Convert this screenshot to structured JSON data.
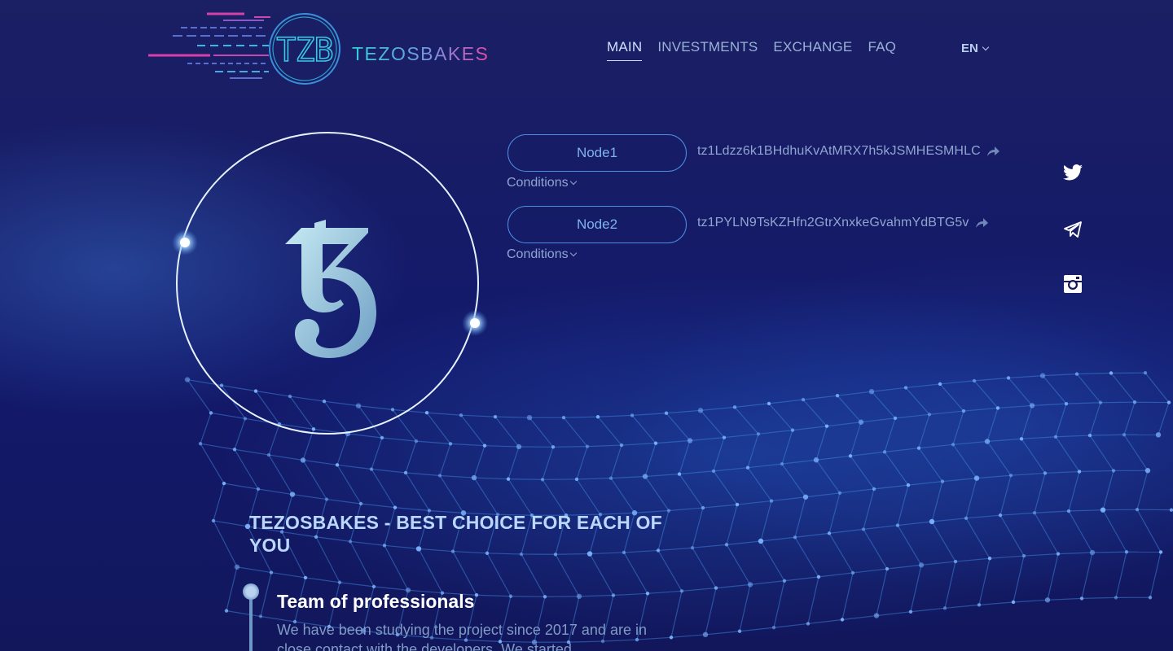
{
  "brand": {
    "monogram": "TZB",
    "name": "TEZOSBAKES",
    "colors": {
      "cyan": "#38c8e6",
      "pink": "#d93fa8",
      "accent": "#4b8fe0",
      "background": "#14185a"
    }
  },
  "nav": {
    "items": [
      {
        "label": "MAIN",
        "active": true
      },
      {
        "label": "INVESTMENTS",
        "active": false
      },
      {
        "label": "EXCHANGE",
        "active": false
      },
      {
        "label": "FAQ",
        "active": false
      }
    ],
    "language": "EN"
  },
  "hero": {
    "symbol_icon": "tezos-symbol-icon",
    "nodes": [
      {
        "label": "Node1",
        "address": "tz1Ldzz6k1BHdhuKvAtMRX7h5kJSMHESMHLC",
        "conditions": "Conditions"
      },
      {
        "label": "Node2",
        "address": "tz1PYLN9TsKZHfn2GtrXnxkeGvahmYdBTG5v",
        "conditions": "Conditions"
      }
    ]
  },
  "social": [
    "twitter-icon",
    "telegram-icon",
    "instagram-icon"
  ],
  "content": {
    "headline": "TEZOSBAKES - BEST CHOICE FOR EACH OF YOU",
    "features": [
      {
        "title": "Team of professionals",
        "text": "We have been studying the project since 2017 and are in close contact with the developers. We started"
      }
    ]
  }
}
